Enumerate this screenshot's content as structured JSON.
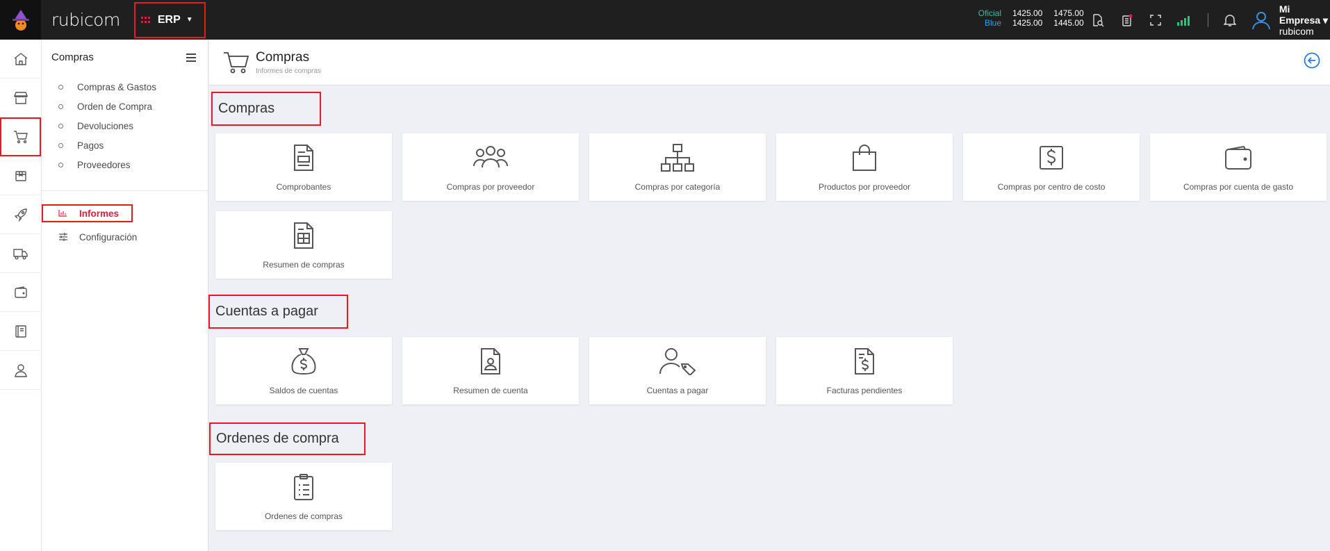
{
  "app": {
    "brand": "rubicom",
    "module": "ERP"
  },
  "rates": {
    "oficial": {
      "label": "Oficial",
      "buy": "1425.00",
      "sell": "1475.00"
    },
    "blue": {
      "label": "Blue",
      "buy": "1425.00",
      "sell": "1445.00"
    }
  },
  "account": {
    "company": "Mi Empresa",
    "user": "rubicom"
  },
  "rail": [
    "home-icon",
    "store-icon",
    "cart-icon",
    "package-icon",
    "rocket-icon",
    "truck-icon",
    "wallet-icon",
    "book-icon",
    "user-icon"
  ],
  "sidemenu": {
    "title": "Compras",
    "items": [
      "Compras & Gastos",
      "Orden de Compra",
      "Devoluciones",
      "Pagos",
      "Proveedores"
    ],
    "informes": "Informes",
    "configuracion": "Configuración"
  },
  "header": {
    "title": "Compras",
    "subtitle": "Informes de compras"
  },
  "sections": {
    "compras": {
      "title": "Compras",
      "cards": [
        "Comprobantes",
        "Compras por proveedor",
        "Compras por categoría",
        "Productos por proveedor",
        "Compras por centro de costo",
        "Compras por cuenta de gasto",
        "Resumen de compras"
      ]
    },
    "cuentas": {
      "title": "Cuentas a pagar",
      "cards": [
        "Saldos de cuentas",
        "Resumen de cuenta",
        "Cuentas a pagar",
        "Facturas pendientes"
      ]
    },
    "ordenes": {
      "title": "Ordenes de compra",
      "cards": [
        "Ordenes de compras"
      ]
    }
  },
  "colors": {
    "topbar": "#1f1f1f",
    "highlight": "#e8191f",
    "active": "#e8193c",
    "accent": "#2a7bd6"
  }
}
